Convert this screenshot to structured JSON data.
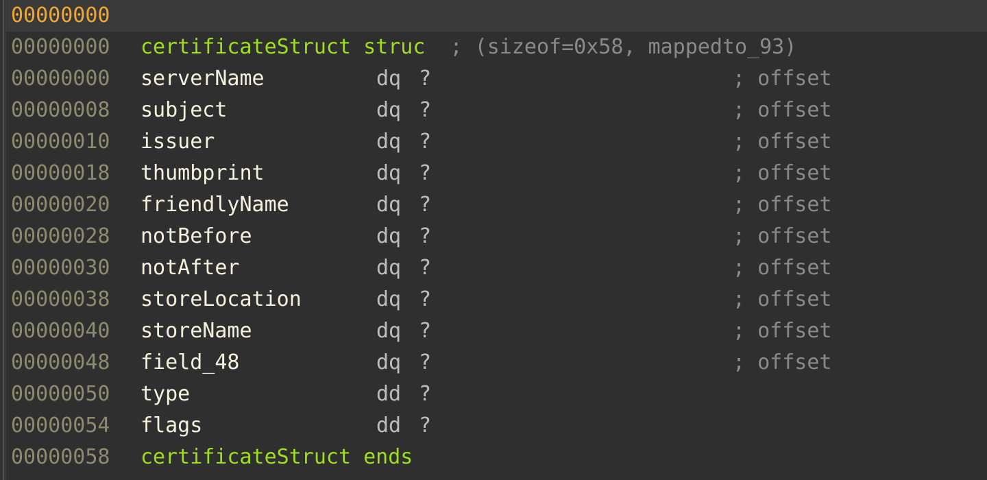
{
  "view": {
    "title": "certificateStruct",
    "kind": "struct-definition-listing",
    "colors": {
      "background": "#2f2f2f",
      "current_line_background": "#3a3a3a",
      "current_address": "#f0a732",
      "address": "#8b8b6d",
      "struct_keyword": "#9ede1f",
      "field_name": "#f2f2de",
      "type_keyword": "#bdbdbd",
      "comment": "#8a8a8a",
      "gutter": "#333333"
    }
  },
  "header_row": {
    "address": "00000000",
    "current": true
  },
  "struct_open": {
    "address": "00000000",
    "name": "certificateStruct",
    "keyword": "struc",
    "comment": "; (sizeof=0x58, mappedto_93)"
  },
  "struct_close": {
    "address": "00000058",
    "name": "certificateStruct",
    "keyword": "ends"
  },
  "fields": [
    {
      "address": "00000000",
      "name": "serverName",
      "type": "dq",
      "value": "?",
      "comment": "; offset"
    },
    {
      "address": "00000008",
      "name": "subject",
      "type": "dq",
      "value": "?",
      "comment": "; offset"
    },
    {
      "address": "00000010",
      "name": "issuer",
      "type": "dq",
      "value": "?",
      "comment": "; offset"
    },
    {
      "address": "00000018",
      "name": "thumbprint",
      "type": "dq",
      "value": "?",
      "comment": "; offset"
    },
    {
      "address": "00000020",
      "name": "friendlyName",
      "type": "dq",
      "value": "?",
      "comment": "; offset"
    },
    {
      "address": "00000028",
      "name": "notBefore",
      "type": "dq",
      "value": "?",
      "comment": "; offset"
    },
    {
      "address": "00000030",
      "name": "notAfter",
      "type": "dq",
      "value": "?",
      "comment": "; offset"
    },
    {
      "address": "00000038",
      "name": "storeLocation",
      "type": "dq",
      "value": "?",
      "comment": "; offset"
    },
    {
      "address": "00000040",
      "name": "storeName",
      "type": "dq",
      "value": "?",
      "comment": "; offset"
    },
    {
      "address": "00000048",
      "name": "field_48",
      "type": "dq",
      "value": "?",
      "comment": "; offset"
    },
    {
      "address": "00000050",
      "name": "type",
      "type": "dd",
      "value": "?",
      "comment": ""
    },
    {
      "address": "00000054",
      "name": "flags",
      "type": "dd",
      "value": "?",
      "comment": ""
    }
  ]
}
